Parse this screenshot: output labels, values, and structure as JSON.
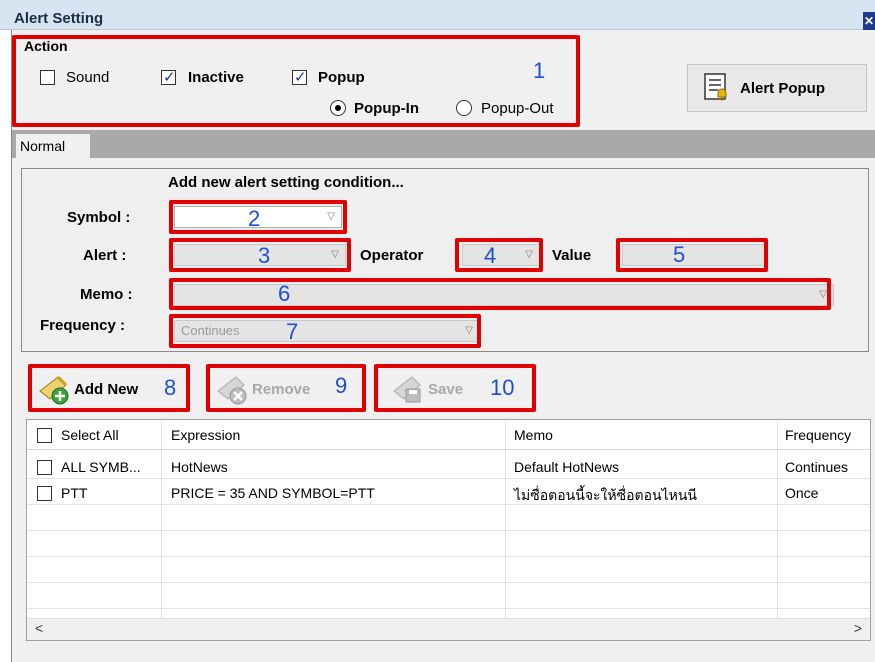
{
  "window": {
    "title": "Alert Setting",
    "close_symbol": "✕"
  },
  "action": {
    "group_label": "Action",
    "sound_label": "Sound",
    "sound_checked": false,
    "inactive_label": "Inactive",
    "inactive_checked": true,
    "popup_label": "Popup",
    "popup_checked": true,
    "popup_in_label": "Popup-In",
    "popup_in_selected": true,
    "popup_out_label": "Popup-Out",
    "popup_out_selected": false
  },
  "alert_popup_button": {
    "label": "Alert Popup",
    "icon": "list-bell-icon"
  },
  "tabs": [
    {
      "label": "Normal",
      "active": true
    }
  ],
  "form": {
    "heading": "Add new alert setting condition...",
    "symbol_label": "Symbol :",
    "symbol_value": "",
    "alert_label": "Alert :",
    "alert_value": "",
    "operator_label": "Operator",
    "operator_value": "",
    "value_label": "Value",
    "value_value": "",
    "memo_label": "Memo :",
    "memo_value": "",
    "frequency_label": "Frequency :",
    "frequency_value": "Continues"
  },
  "buttons": {
    "add_new": "Add New",
    "remove": "Remove",
    "save": "Save"
  },
  "table": {
    "select_all_label": "Select All",
    "columns": [
      "Expression",
      "Memo",
      "Frequency"
    ],
    "rows": [
      {
        "symbol": "ALL SYMB...",
        "expression": "HotNews",
        "memo": "Default HotNews",
        "frequency": "Continues"
      },
      {
        "symbol": "PTT",
        "expression": "PRICE = 35 AND SYMBOL=PTT",
        "memo": "ไม่ซื่อตอนนี้จะให้ซื่อตอนไหนนี",
        "frequency": "Once"
      }
    ],
    "scroll_left": "<",
    "scroll_right": ">"
  },
  "annotations": {
    "n1": "1",
    "n2": "2",
    "n3": "3",
    "n4": "4",
    "n5": "5",
    "n6": "6",
    "n7": "7",
    "n8": "8",
    "n9": "9",
    "n10": "10"
  },
  "colors": {
    "annotation_red": "#e00000",
    "annotation_blue": "#1a4fd6",
    "title_bar": "#d7e4f2"
  }
}
